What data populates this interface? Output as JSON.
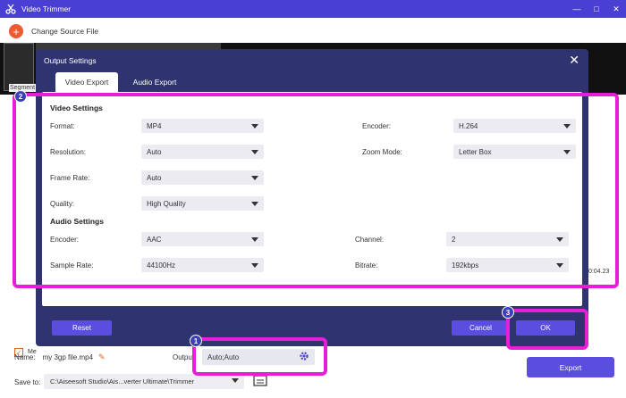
{
  "window": {
    "title": "Video Trimmer",
    "controls": [
      "minimize",
      "maximize",
      "close"
    ]
  },
  "main": {
    "change_source_label": "Change Source File",
    "segment_label": "Segment",
    "time_fragment": "0:04.23",
    "merge_label": "Me",
    "merge_checked": true,
    "name_label": "Name:",
    "name_value": "my 3gp file.mp4",
    "output_label": "Output:",
    "output_value": "Auto;Auto",
    "save_to_label": "Save to:",
    "save_to_value": "C:\\Aiseesoft Studio\\Ais...verter Ultimate\\Trimmer",
    "export_label": "Export"
  },
  "dialog": {
    "title": "Output Settings",
    "tabs": [
      {
        "label": "Video Export",
        "active": true
      },
      {
        "label": "Audio Export",
        "active": false
      }
    ],
    "video_settings_heading": "Video Settings",
    "audio_settings_heading": "Audio Settings",
    "video": {
      "format": {
        "label": "Format:",
        "value": "MP4"
      },
      "resolution": {
        "label": "Resolution:",
        "value": "Auto"
      },
      "frame_rate": {
        "label": "Frame Rate:",
        "value": "Auto"
      },
      "quality": {
        "label": "Quality:",
        "value": "High Quality"
      },
      "encoder": {
        "label": "Encoder:",
        "value": "H.264"
      },
      "zoom_mode": {
        "label": "Zoom Mode:",
        "value": "Letter Box"
      }
    },
    "audio": {
      "encoder": {
        "label": "Encoder:",
        "value": "AAC"
      },
      "sample_rate": {
        "label": "Sample Rate:",
        "value": "44100Hz"
      },
      "channel": {
        "label": "Channel:",
        "value": "2"
      },
      "bitrate": {
        "label": "Bitrate:",
        "value": "192kbps"
      }
    },
    "reset_label": "Reset",
    "cancel_label": "Cancel",
    "ok_label": "OK"
  },
  "annotations": {
    "badge_1": "1",
    "badge_2": "2",
    "badge_3": "3",
    "highlight_color": "#e51ed8"
  },
  "colors": {
    "accent": "#5a4de0",
    "titlebar": "#4a3fd3",
    "dialog_bg": "#2f3470",
    "orange": "#f05a32"
  }
}
